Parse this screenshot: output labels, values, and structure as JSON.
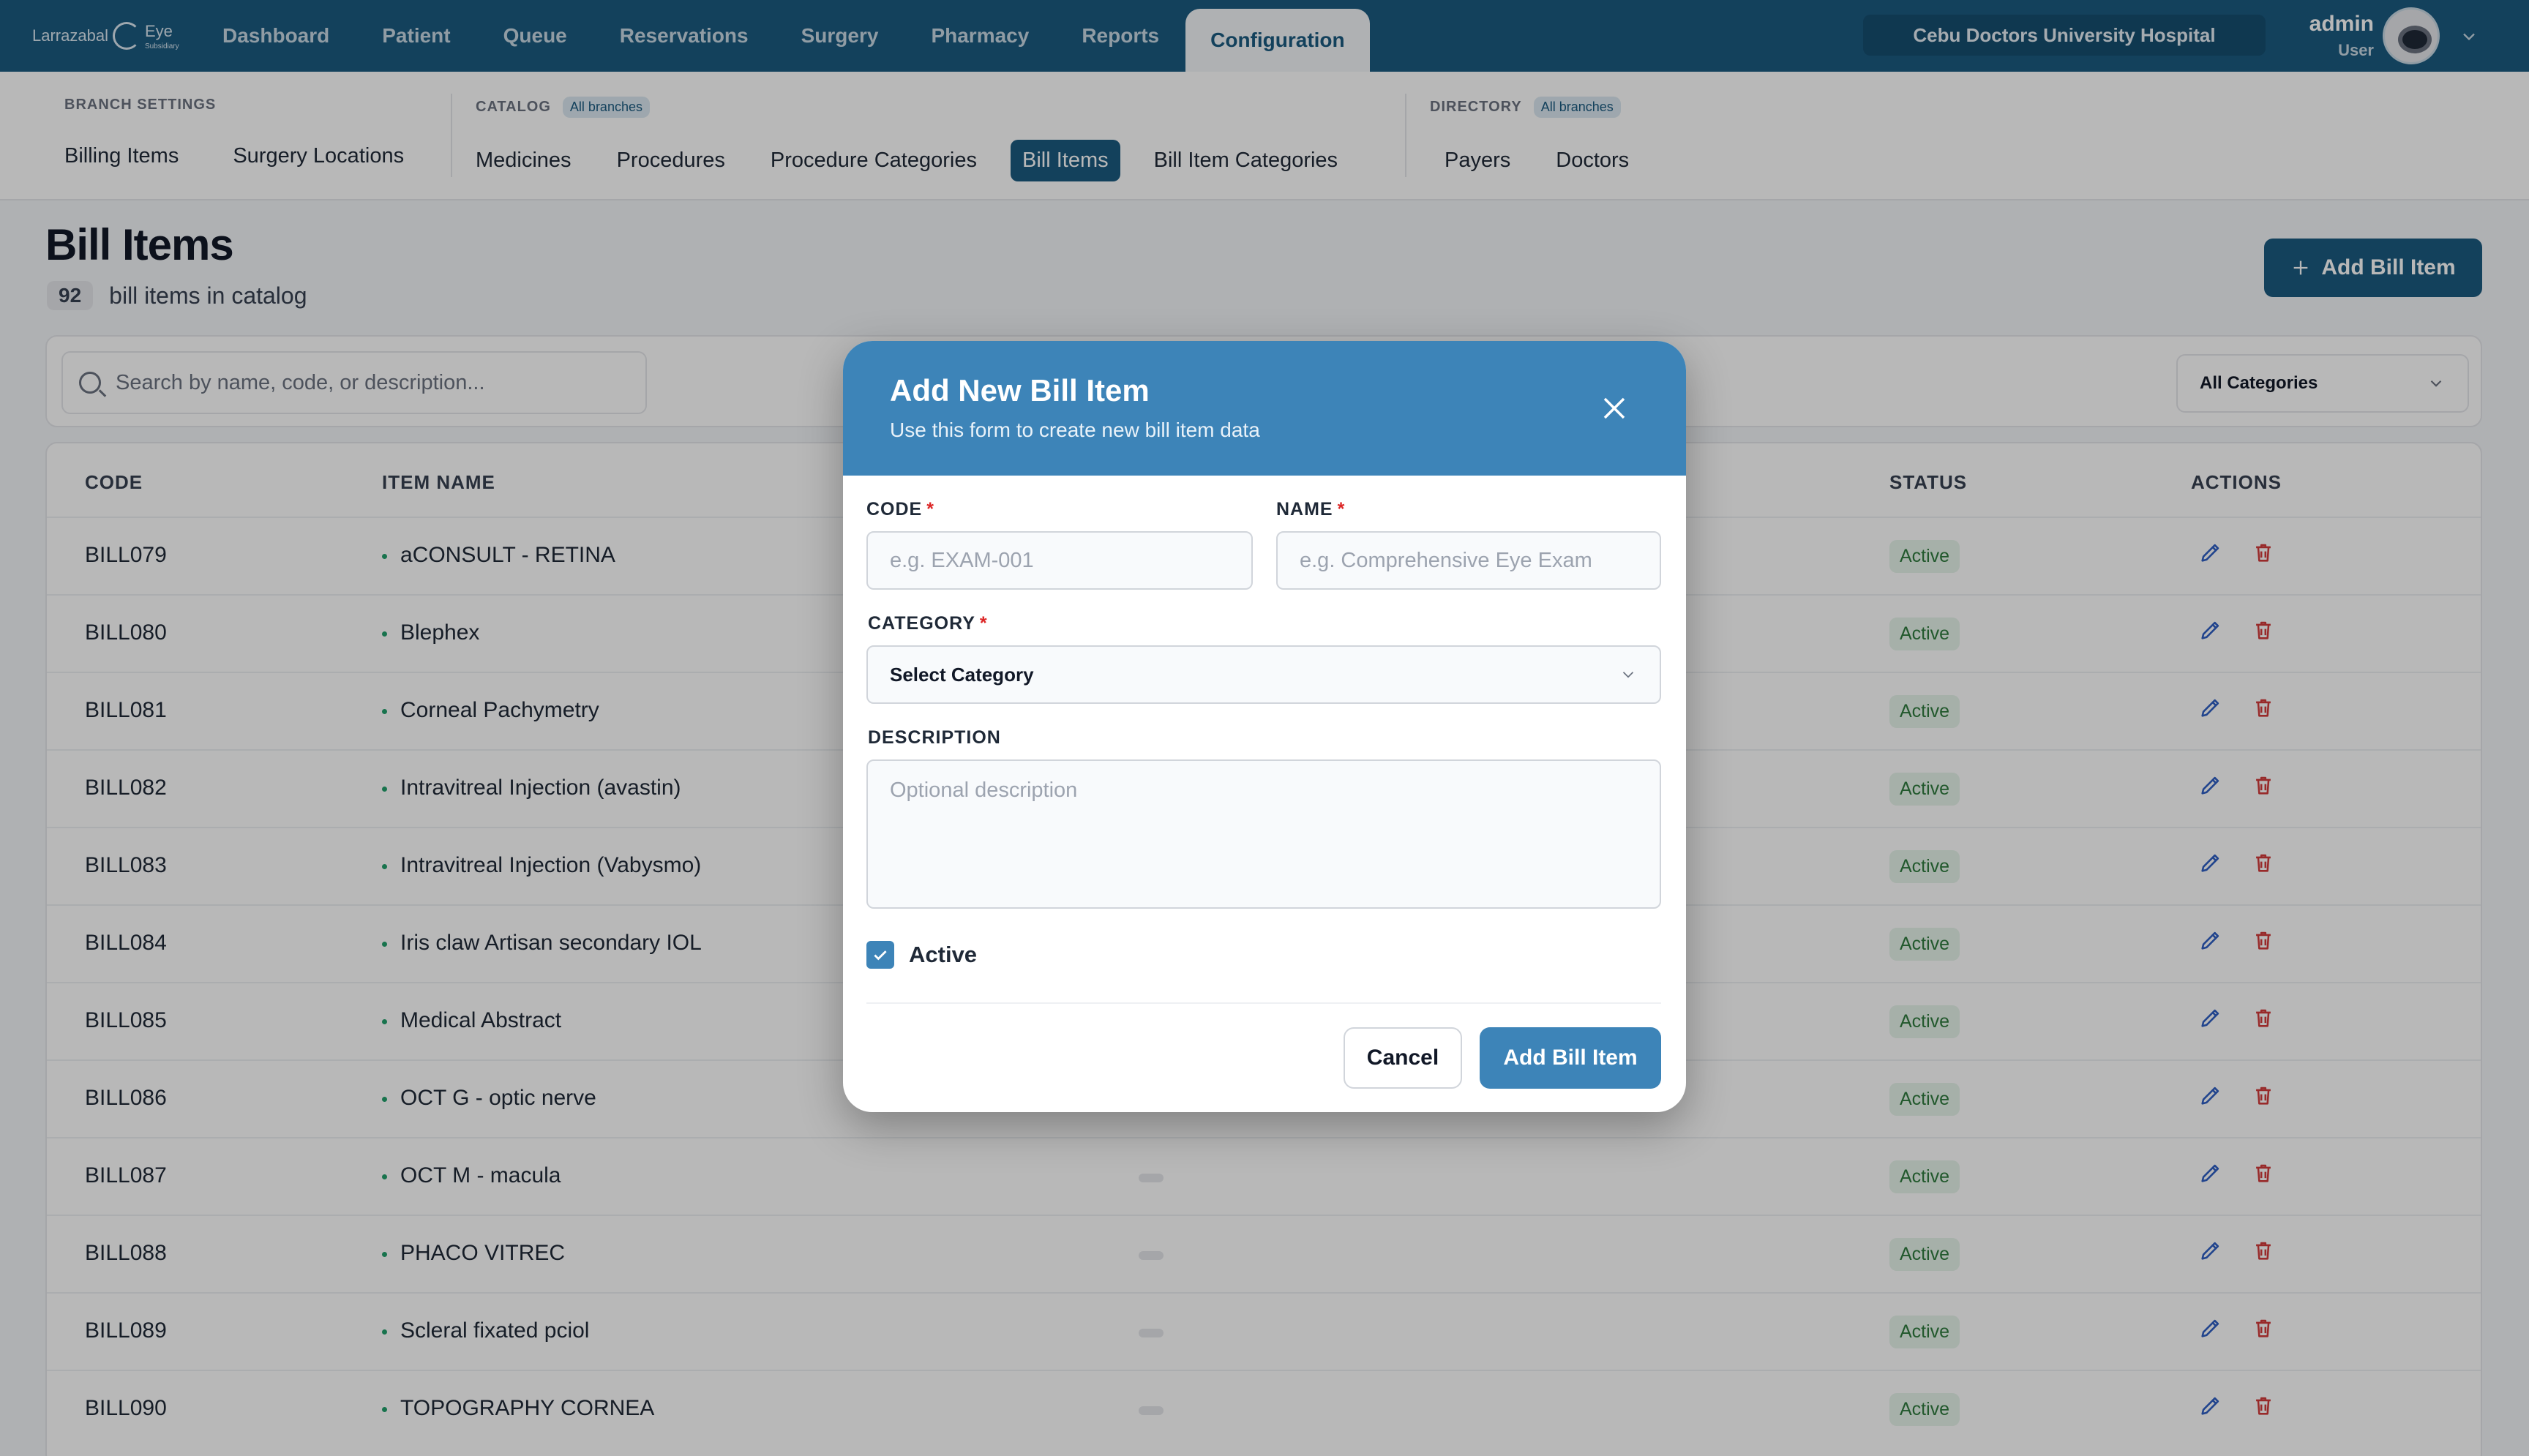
{
  "brand": {
    "name": "Larrazabal",
    "name2": "Eye",
    "tag": "Subsidiary"
  },
  "nav": {
    "items": [
      {
        "label": "Dashboard"
      },
      {
        "label": "Patient"
      },
      {
        "label": "Queue"
      },
      {
        "label": "Reservations"
      },
      {
        "label": "Surgery"
      },
      {
        "label": "Pharmacy"
      },
      {
        "label": "Reports"
      },
      {
        "label": "Configuration",
        "active": true
      }
    ]
  },
  "hospital": "Cebu Doctors University Hospital",
  "user": {
    "name": "admin",
    "role": "User"
  },
  "subnav": {
    "groups": [
      {
        "label": "BRANCH SETTINGS",
        "badge": "",
        "items": [
          "Billing Items",
          "Surgery Locations"
        ]
      },
      {
        "label": "CATALOG",
        "badge": "All branches",
        "items": [
          "Medicines",
          "Procedures",
          "Procedure Categories",
          "Bill Items",
          "Bill Item Categories"
        ]
      },
      {
        "label": "DIRECTORY",
        "badge": "All branches",
        "items": [
          "Payers",
          "Doctors"
        ]
      }
    ],
    "active": "Bill Items"
  },
  "page": {
    "title": "Bill Items",
    "count": "92",
    "count_label": "bill items in catalog",
    "add_button": "Add Bill Item",
    "search_placeholder": "Search by name, code, or description...",
    "category_filter": "All Categories"
  },
  "table": {
    "headers": {
      "code": "CODE",
      "name": "ITEM NAME",
      "status": "STATUS",
      "actions": "ACTIONS"
    },
    "rows": [
      {
        "code": "BILL079",
        "name": "aCONSULT - RETINA",
        "status": "Active"
      },
      {
        "code": "BILL080",
        "name": "Blephex",
        "status": "Active"
      },
      {
        "code": "BILL081",
        "name": "Corneal Pachymetry",
        "status": "Active"
      },
      {
        "code": "BILL082",
        "name": "Intravitreal Injection (avastin)",
        "status": "Active"
      },
      {
        "code": "BILL083",
        "name": "Intravitreal Injection (Vabysmo)",
        "status": "Active"
      },
      {
        "code": "BILL084",
        "name": "Iris claw Artisan secondary IOL",
        "status": "Active"
      },
      {
        "code": "BILL085",
        "name": "Medical Abstract",
        "status": "Active"
      },
      {
        "code": "BILL086",
        "name": "OCT G - optic nerve",
        "status": "Active"
      },
      {
        "code": "BILL087",
        "name": "OCT M - macula",
        "status": "Active"
      },
      {
        "code": "BILL088",
        "name": "PHACO VITREC",
        "status": "Active"
      },
      {
        "code": "BILL089",
        "name": "Scleral fixated pciol",
        "status": "Active"
      },
      {
        "code": "BILL090",
        "name": "TOPOGRAPHY CORNEA",
        "status": "Active"
      }
    ]
  },
  "modal": {
    "title": "Add New Bill Item",
    "subtitle": "Use this form to create new bill item data",
    "code_label": "CODE",
    "code_placeholder": "e.g. EXAM-001",
    "code_value": "",
    "name_label": "NAME",
    "name_placeholder": "e.g. Comprehensive Eye Exam",
    "name_value": "",
    "category_label": "CATEGORY",
    "category_value": "Select Category",
    "description_label": "DESCRIPTION",
    "description_placeholder": "Optional description",
    "active_label": "Active",
    "active_checked": true,
    "required_mark": "*",
    "cancel": "Cancel",
    "submit": "Add Bill Item"
  },
  "colors": {
    "topbar": "#1b5a80",
    "modal_header": "#3d84b8",
    "primary": "#1b5a80",
    "status_bg": "#e6f4ea",
    "status_text": "#2f7a3d",
    "edit_icon": "#2f5fc4",
    "delete_icon": "#d33b3b"
  },
  "icons": {
    "search": "search-icon",
    "close": "close-icon",
    "chevron": "chevron-down-icon",
    "edit": "pencil-icon",
    "delete": "trash-icon",
    "add": "plus-icon",
    "check": "check-icon"
  }
}
